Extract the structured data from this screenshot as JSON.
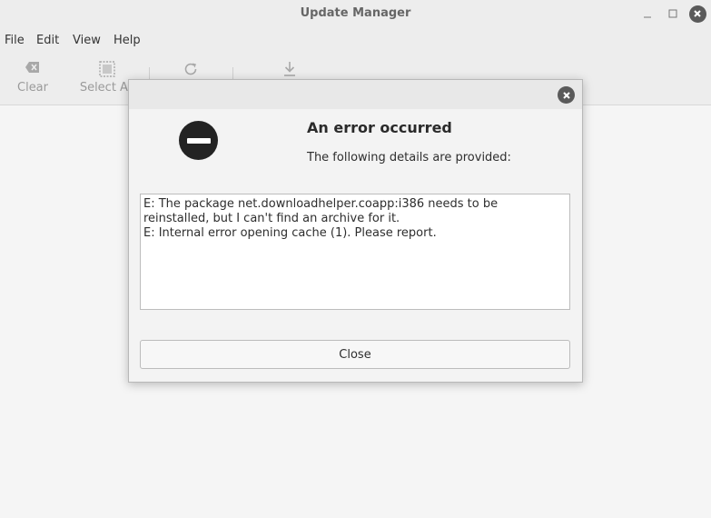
{
  "window": {
    "title": "Update Manager"
  },
  "menu": {
    "items": [
      "File",
      "Edit",
      "View",
      "Help"
    ]
  },
  "toolbar": {
    "clear_label": "Clear",
    "select_all_label": "Select All"
  },
  "dialog": {
    "title": "An error occurred",
    "subtitle": "The following details are provided:",
    "details": [
      "E: The package net.downloadhelper.coapp:i386 needs to be reinstalled, but I can't find an archive for it.",
      "E: Internal error opening cache (1). Please report."
    ],
    "close_label": "Close"
  },
  "colors": {
    "window_bg": "#f5f5f5",
    "titlebar_bg": "#ededed",
    "error_icon": "#232323"
  }
}
